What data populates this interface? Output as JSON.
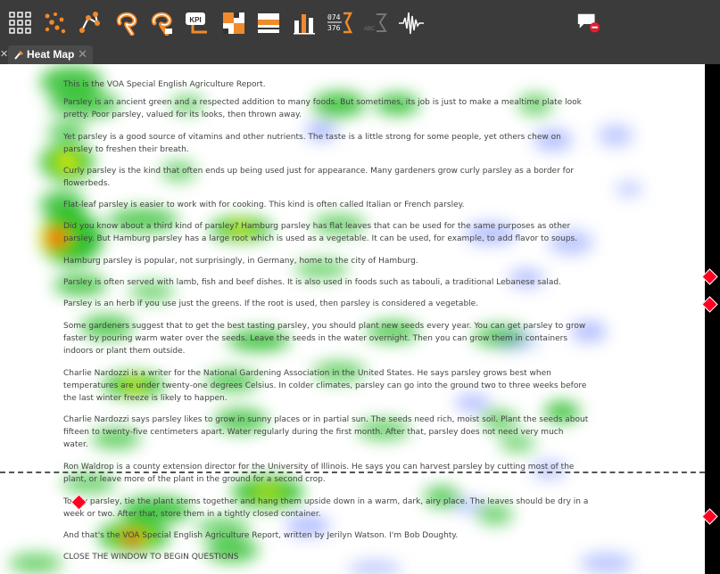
{
  "toolbar": {
    "icons": [
      "grid-icon",
      "dots-icon",
      "path-icon",
      "lasso-icon",
      "lasso-tool-icon",
      "kpi-icon",
      "checker-icon",
      "rows-icon",
      "bars-icon",
      "stats-icon",
      "sigma-icon",
      "waveform-icon",
      "comment-remove-icon"
    ],
    "stats_top": "074",
    "stats_bottom": "376",
    "kpi_label": "KPI",
    "abc_label": "ABC"
  },
  "tabs": [
    {
      "label": "Heat Map",
      "close": "✕"
    }
  ],
  "left_tab_close": "✕",
  "document": {
    "lines": [
      "This is the VOA Special English Agriculture Report.",
      "Parsley is an ancient green and a respected addition to many foods. But sometimes, its job is just to make a mealtime plate look",
      "pretty. Poor parsley, valued for its looks, then thrown away.",
      "Yet parsley is a good source of vitamins and other nutrients. The taste is a little strong for some people, yet others chew on",
      "parsley to freshen their breath.",
      "Curly parsley is the kind that often ends up being used just for appearance. Many gardeners grow curly parsley as a border for",
      "flowerbeds.",
      "Flat-leaf parsley is easier to work with for cooking. This kind is often called Italian or French parsley.",
      "Did you know about a third kind of parsley? Hamburg parsley has flat leaves that can be used for the same purposes as other",
      "parsley. But Hamburg parsley has a large root which is used as a vegetable. It can be used, for example, to add flavor to soups.",
      "Hamburg parsley is popular, not surprisingly, in Germany, home to the city of Hamburg.",
      "Parsley is often served with lamb, fish and beef dishes. It is also used in foods such as tabouli, a traditional Lebanese salad.",
      "Parsley is an herb if you use just the greens. If the root is used, then parsley is considered a vegetable.",
      "Some gardeners suggest that to get the best tasting parsley, you should plant new seeds every year. You can get parsley to grow",
      "faster by pouring warm water over the seeds. Leave the seeds in the water overnight. Then you can grow them in containers",
      "indoors or plant them outside.",
      "Charlie Nardozzi is a writer for the National Gardening Association in the United States. He says parsley grows best when",
      "temperatures are under twenty-one degrees Celsius. In colder climates, parsley can go into the ground two to three weeks before",
      "the last winter freeze is likely to happen.",
      "Charlie Nardozzi says parsley likes to grow in sunny places or in partial sun. The seeds need rich, moist soil. Plant the seeds about",
      "fifteen to twenty-five centimeters apart. Water regularly during the first month. After that, parsley does not need very much",
      "water.",
      "Ron Waldrop is a county extension director for the University of Illinois. He says you can harvest parsley by cutting most of the",
      "plant, or leave more of the plant in the ground for a second crop.",
      "To dry parsley, tie the plant stems together and hang them upside down in a warm, dark, airy place. The leaves should be dry in a",
      "week or two. After that, store them in a tightly closed container.",
      "And that's the VOA Special English Agriculture Report, written by Jerilyn Watson. I'm Bob Doughty.",
      "CLOSE THE WINDOW TO BEGIN QUESTIONS"
    ]
  },
  "colors": {
    "toolbar_bg": "#3b3b3b",
    "icon_accent": "#f08a2b",
    "heat_green": "#18b818",
    "heat_yellow": "#f4f000",
    "heat_red": "#ff2200",
    "heat_blue": "#4060ff",
    "marker": "#ff0022"
  }
}
